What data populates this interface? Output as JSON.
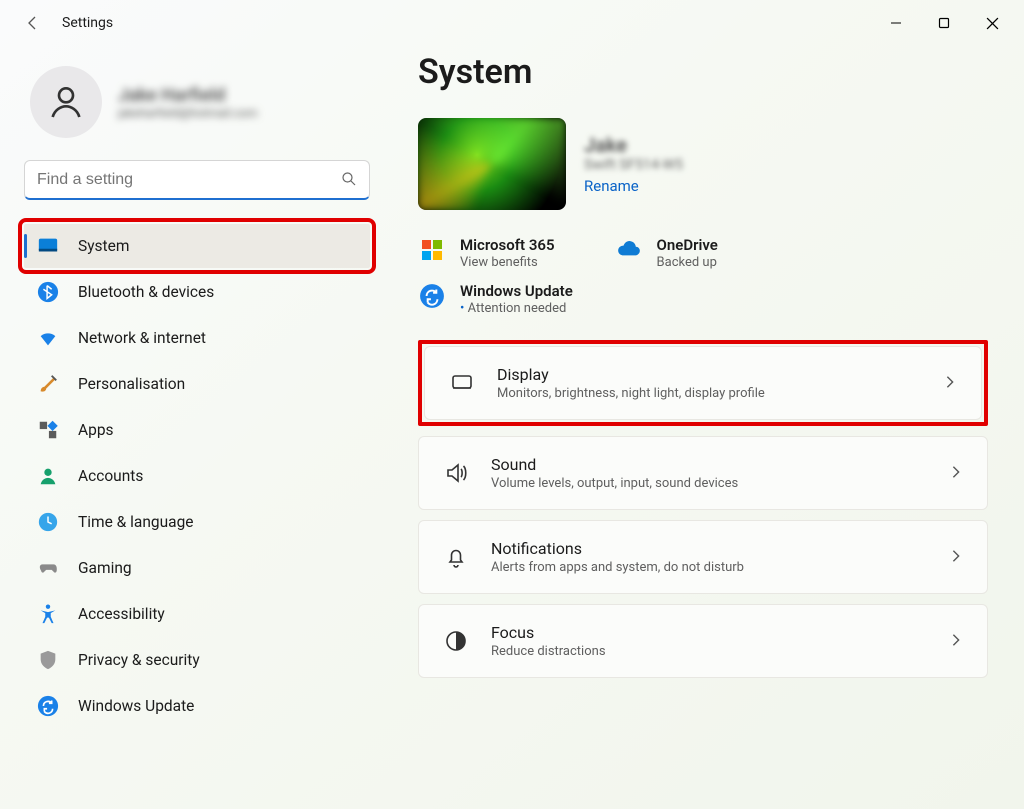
{
  "window": {
    "title": "Settings"
  },
  "profile": {
    "name": "Jake Harfield",
    "email": "jakeharfield@hotmail.com"
  },
  "search": {
    "placeholder": "Find a setting"
  },
  "sidebar": {
    "items": [
      {
        "label": "System"
      },
      {
        "label": "Bluetooth & devices"
      },
      {
        "label": "Network & internet"
      },
      {
        "label": "Personalisation"
      },
      {
        "label": "Apps"
      },
      {
        "label": "Accounts"
      },
      {
        "label": "Time & language"
      },
      {
        "label": "Gaming"
      },
      {
        "label": "Accessibility"
      },
      {
        "label": "Privacy & security"
      },
      {
        "label": "Windows Update"
      }
    ]
  },
  "main": {
    "heading": "System",
    "device": {
      "name": "Jake",
      "model": "Swift SF514-W5",
      "rename": "Rename"
    },
    "status": {
      "m365": {
        "label": "Microsoft 365",
        "sub": "View benefits"
      },
      "onedrive": {
        "label": "OneDrive",
        "sub": "Backed up"
      },
      "winupdate": {
        "label": "Windows Update",
        "sub": "Attention needed"
      }
    },
    "cards": [
      {
        "title": "Display",
        "sub": "Monitors, brightness, night light, display profile"
      },
      {
        "title": "Sound",
        "sub": "Volume levels, output, input, sound devices"
      },
      {
        "title": "Notifications",
        "sub": "Alerts from apps and system, do not disturb"
      },
      {
        "title": "Focus",
        "sub": "Reduce distractions"
      }
    ]
  }
}
